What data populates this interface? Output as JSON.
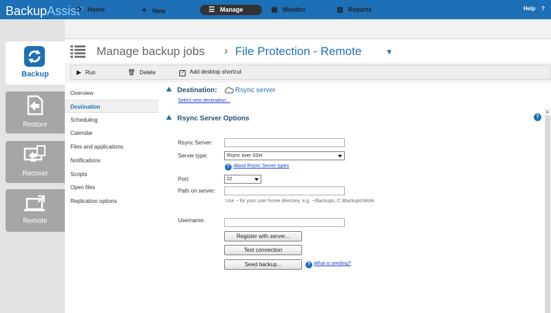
{
  "app": {
    "logo_main": "Backup",
    "logo_accent": "Assist",
    "logo_mark": "®",
    "help_label": "Help",
    "help_icon": "?"
  },
  "left_nav": [
    {
      "label": "Backup",
      "icon": "backup-sync-icon",
      "active": true
    },
    {
      "label": "Restore",
      "icon": "restore-document-icon",
      "active": false
    },
    {
      "label": "Recover",
      "icon": "recover-computer-icon",
      "active": false
    },
    {
      "label": "Remote",
      "icon": "remote-laptop-icon",
      "active": false
    }
  ],
  "top_nav": {
    "home": "Home",
    "new": "New",
    "manage": "Manage",
    "monitor": "Monitor",
    "reports": "Reports"
  },
  "title": {
    "breadcrumb": "Manage backup jobs",
    "separator": "›",
    "job_name": "File Protection - Remote",
    "dropdown_glyph": "▼"
  },
  "toolbar": {
    "run": "Run",
    "delete": "Delete",
    "add_shortcut": "Add desktop shortcut"
  },
  "side_menu": [
    {
      "label": "Overview",
      "active": false
    },
    {
      "label": "Destination",
      "active": true
    },
    {
      "label": "Scheduling",
      "active": false
    },
    {
      "label": "Calendar",
      "active": false
    },
    {
      "label": "Files and applications",
      "active": false
    },
    {
      "label": "Notifications",
      "active": false
    },
    {
      "label": "Scripts",
      "active": false
    },
    {
      "label": "Open files",
      "active": false
    },
    {
      "label": "Replication options",
      "active": false
    }
  ],
  "destination": {
    "header": "Destination:",
    "value": "Rsync server",
    "select_link": "Select new destination..."
  },
  "rsync": {
    "header": "Rsync Server Options",
    "server_label": "Rsync Server:",
    "server_value": "",
    "type_label": "Server type:",
    "type_value": "Rsync over SSH",
    "about_link": "About Rsync Server types",
    "port_label": "Port:",
    "port_value": "22",
    "path_label": "Path on server:",
    "path_value": "",
    "path_hint": "Use ~ for your user home directory. e.g. ~/Backups, C:\\Backups\\Work",
    "username_label": "Username:",
    "username_value": "",
    "register_button": "Register with server...",
    "test_button": "Test connection",
    "seed_button": "Seed backup...",
    "seeding_link": "What is seeding?"
  },
  "colors": {
    "brand_blue": "#1d6fb6",
    "nav_tile_grey": "#a6a6a6",
    "link_blue": "#1d3fcc"
  }
}
